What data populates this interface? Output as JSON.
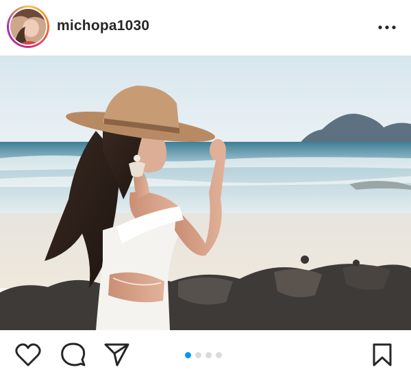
{
  "post": {
    "username": "michopa1030",
    "avatar_icon": "profile-photo",
    "more_icon": "more-horizontal-icon",
    "photo_description_icon": "beach-photo",
    "carousel": {
      "count": 4,
      "active_index": 0
    },
    "actions": {
      "like_icon": "heart-icon",
      "comment_icon": "comment-icon",
      "share_icon": "send-icon",
      "save_icon": "bookmark-icon"
    },
    "colors": {
      "active_dot": "#0095f6",
      "inactive_dot": "#dbdbdb",
      "text": "#262626"
    }
  }
}
